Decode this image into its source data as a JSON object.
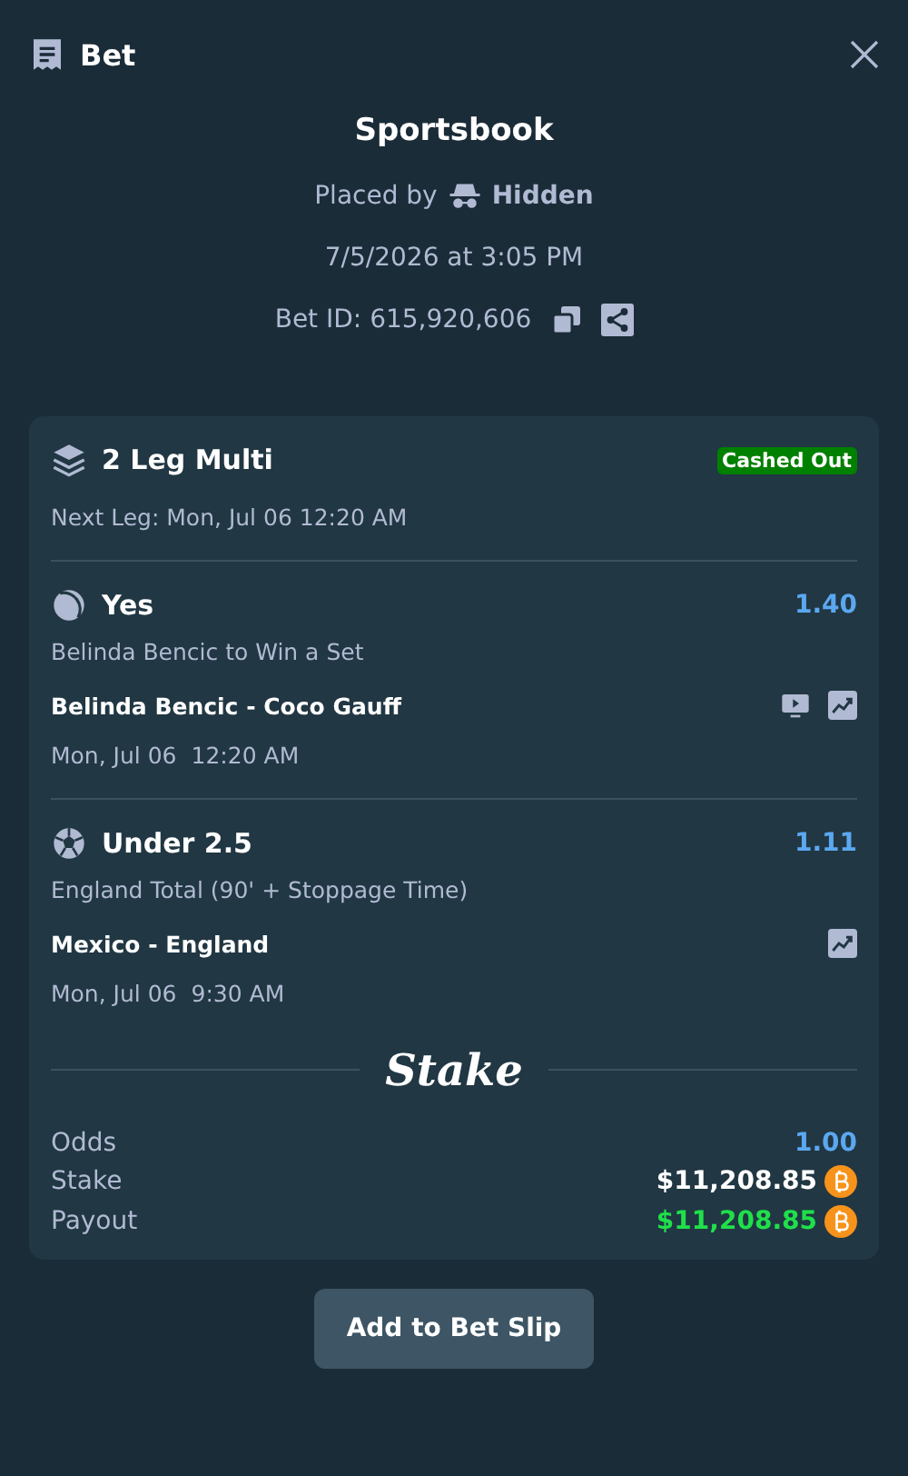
{
  "header": {
    "title": "Bet"
  },
  "summary": {
    "source": "Sportsbook",
    "placed_by_label": "Placed by",
    "placed_by_user": "Hidden",
    "placed_at": "7/5/2026 at 3:05 PM",
    "bet_id": "Bet ID: 615,920,606"
  },
  "bet": {
    "title": "2 Leg Multi",
    "status": "Cashed Out",
    "next_leg": "Next Leg: Mon, Jul 06 12:20 AM"
  },
  "legs": [
    {
      "kind": "tennis",
      "selection": "Yes",
      "odds": "1.40",
      "market": "Belinda Bencic to Win a Set",
      "match": "Belinda Bencic - Coco Gauff",
      "has_stream": true,
      "date": "Mon, Jul 06",
      "time": "12:20 AM"
    },
    {
      "kind": "soccer",
      "selection": "Under 2.5",
      "odds": "1.11",
      "market": "England Total (90' + Stoppage Time)",
      "match": "Mexico - England",
      "has_stream": false,
      "date": "Mon, Jul 06",
      "time": "9:30 AM"
    }
  ],
  "logo": "Stake",
  "totals": [
    {
      "kind": "odds",
      "label": "Odds",
      "value": "1.00"
    },
    {
      "kind": "amount",
      "label": "Stake",
      "value": "$11,208.85"
    },
    {
      "kind": "payout",
      "label": "Payout",
      "value": "$11,208.85"
    }
  ],
  "button": "Add to Bet Slip"
}
